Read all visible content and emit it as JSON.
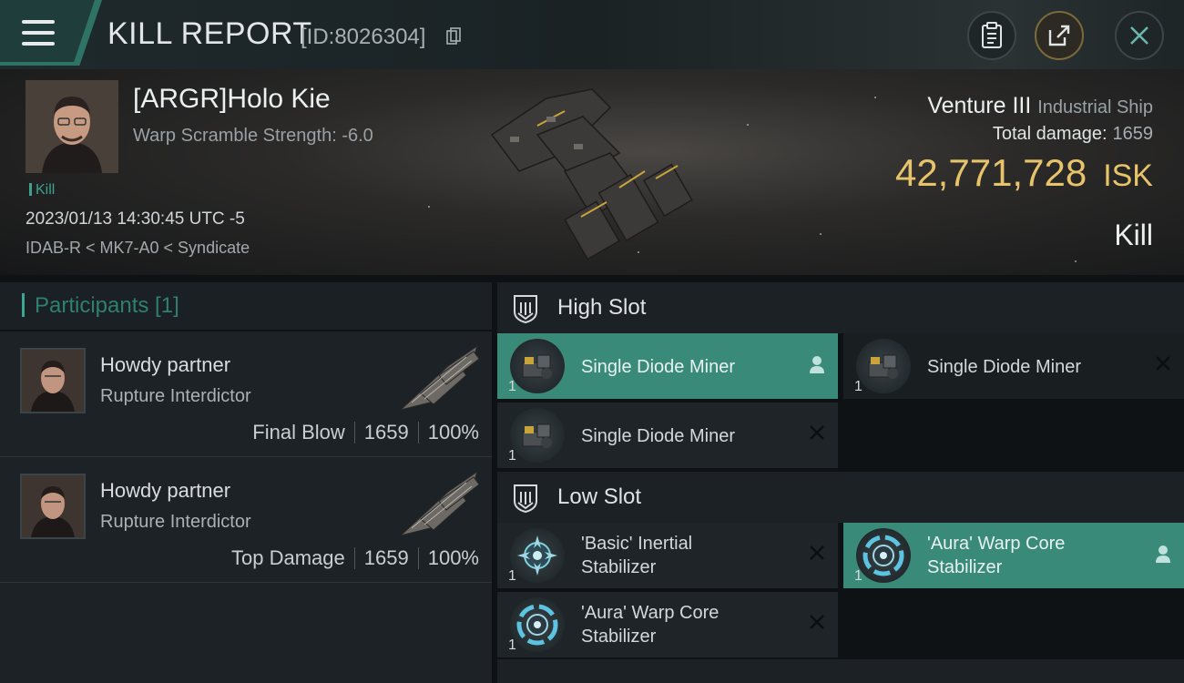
{
  "header": {
    "title": "KILL REPORT",
    "id_text": "[ID:8026304]"
  },
  "victim": {
    "pilot_name": "[ARGR]Holo Kie",
    "warp_scramble": "Warp Scramble Strength: -6.0",
    "tag": "Kill",
    "timestamp": "2023/01/13 14:30:45 UTC -5",
    "location": "IDAB-R < MK7-A0 < Syndicate",
    "ship_name": "Venture III",
    "ship_class": "Industrial Ship",
    "total_damage_label": "Total damage:",
    "total_damage_value": "1659",
    "isk_value": "42,771,728",
    "isk_unit": "ISK",
    "result": "Kill"
  },
  "participants": {
    "header": "Participants [1]",
    "rows": [
      {
        "name": "Howdy partner",
        "ship": "Rupture Interdictor",
        "role": "Final Blow",
        "damage": "1659",
        "percent": "100%"
      },
      {
        "name": "Howdy partner",
        "ship": "Rupture Interdictor",
        "role": "Top Damage",
        "damage": "1659",
        "percent": "100%"
      }
    ]
  },
  "slots": {
    "high_label": "High Slot",
    "high_modules": [
      {
        "name": "Single Diode Miner",
        "qty": "1",
        "state": "dropped"
      },
      {
        "name": "Single Diode Miner",
        "qty": "1",
        "state": "destroyed"
      },
      {
        "name": "Single Diode Miner",
        "qty": "1",
        "state": "destroyed"
      }
    ],
    "low_label": "Low Slot",
    "low_modules": [
      {
        "name_line1": "'Basic' Inertial",
        "name_line2": "Stabilizer",
        "qty": "1",
        "state": "destroyed"
      },
      {
        "name_line1": "'Aura' Warp Core",
        "name_line2": "Stabilizer",
        "qty": "1",
        "state": "dropped"
      },
      {
        "name_line1": "'Aura' Warp Core",
        "name_line2": "Stabilizer",
        "qty": "1",
        "state": "destroyed"
      }
    ]
  },
  "colors": {
    "accent": "#3a8a7a",
    "isk": "#e7c36a",
    "panel": "#1e2427"
  }
}
